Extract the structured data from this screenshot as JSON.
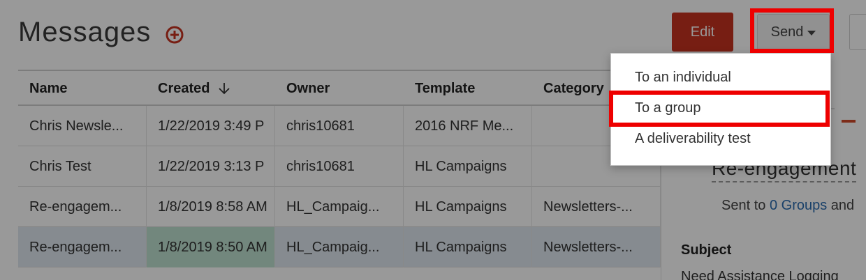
{
  "header": {
    "title": "Messages",
    "edit_label": "Edit",
    "send_label": "Send"
  },
  "table": {
    "columns": [
      "Name",
      "Created",
      "Owner",
      "Template",
      "Category"
    ],
    "rows": [
      [
        "Chris Newsle...",
        "1/22/2019 3:49 P",
        "chris10681",
        "2016 NRF Me...",
        ""
      ],
      [
        "Chris Test",
        "1/22/2019 3:13 P",
        "chris10681",
        "HL Campaigns",
        ""
      ],
      [
        "Re-engagem...",
        "1/8/2019 8:58 AM",
        "HL_Campaig...",
        "HL Campaigns",
        "Newsletters-..."
      ],
      [
        "Re-engagem...",
        "1/8/2019 8:50 AM",
        "HL_Campaig...",
        "HL Campaigns",
        "Newsletters-..."
      ]
    ]
  },
  "send_menu": {
    "items": [
      "To an individual",
      "To a group",
      "A deliverability test"
    ]
  },
  "preview": {
    "title": "Re-engagement",
    "sent_prefix": "Sent to",
    "sent_link": "0 Groups",
    "sent_suffix": "and",
    "subject_label": "Subject",
    "subject_value": "Need Assistance Logging"
  },
  "colors": {
    "accent": "#c63320",
    "highlight": "#ee0000",
    "link": "#2b6cb0",
    "selected_row": "#dfe8f0"
  },
  "icons": {
    "add": "plus-circle-icon",
    "sort": "arrow-down-icon",
    "caret": "caret-down-icon"
  }
}
